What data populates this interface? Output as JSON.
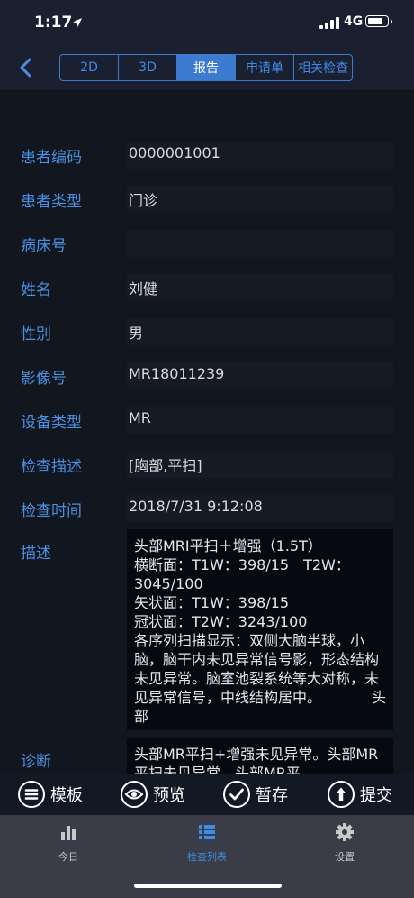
{
  "status_bar": {
    "time": "1:17",
    "network": "4G"
  },
  "nav": {
    "tabs": [
      {
        "label": "2D",
        "active": false
      },
      {
        "label": "3D",
        "active": false
      },
      {
        "label": "报告",
        "active": true
      },
      {
        "label": "申请单",
        "active": false
      },
      {
        "label": "相关检查",
        "active": false
      }
    ]
  },
  "form": {
    "fields": [
      {
        "label": "患者编码",
        "value": "0000001001"
      },
      {
        "label": "患者类型",
        "value": "门诊"
      },
      {
        "label": "病床号",
        "value": ""
      },
      {
        "label": "姓名",
        "value": "刘健"
      },
      {
        "label": "性别",
        "value": "男"
      },
      {
        "label": "影像号",
        "value": "MR18011239"
      },
      {
        "label": "设备类型",
        "value": "MR"
      },
      {
        "label": "检查描述",
        "value": "[胸部,平扫]"
      },
      {
        "label": "检查时间",
        "value": "2018/7/31 9:12:08"
      }
    ],
    "description": {
      "label": "描述",
      "value": "头部MRI平扫＋增强（1.5T）\n横断面：T1W：398/15　T2W：3045/100\n矢状面：T1W：398/15\n冠状面：T2W：3243/100\n各序列扫描显示：双侧大脑半球，小脑，脑干内未见异常信号影，形态结构未见异常。脑室池裂系统等大对称，未见异常信号，中线结构居中。　　　　头部"
    },
    "diagnosis": {
      "label": "诊断",
      "value": "头部MR平扫+增强未见异常。头部MR平扫未见异常。头部MR平"
    }
  },
  "actions": {
    "template": "模板",
    "preview": "预览",
    "save_draft": "暂存",
    "submit": "提交"
  },
  "tabbar": {
    "items": [
      {
        "label": "今日",
        "icon": "bar-chart-icon",
        "active": false
      },
      {
        "label": "检查列表",
        "icon": "list-icon",
        "active": true
      },
      {
        "label": "设置",
        "icon": "gear-icon",
        "active": false
      }
    ]
  },
  "colors": {
    "accent": "#3d7bd0",
    "label": "#4a90e2",
    "background": "#11161f"
  }
}
